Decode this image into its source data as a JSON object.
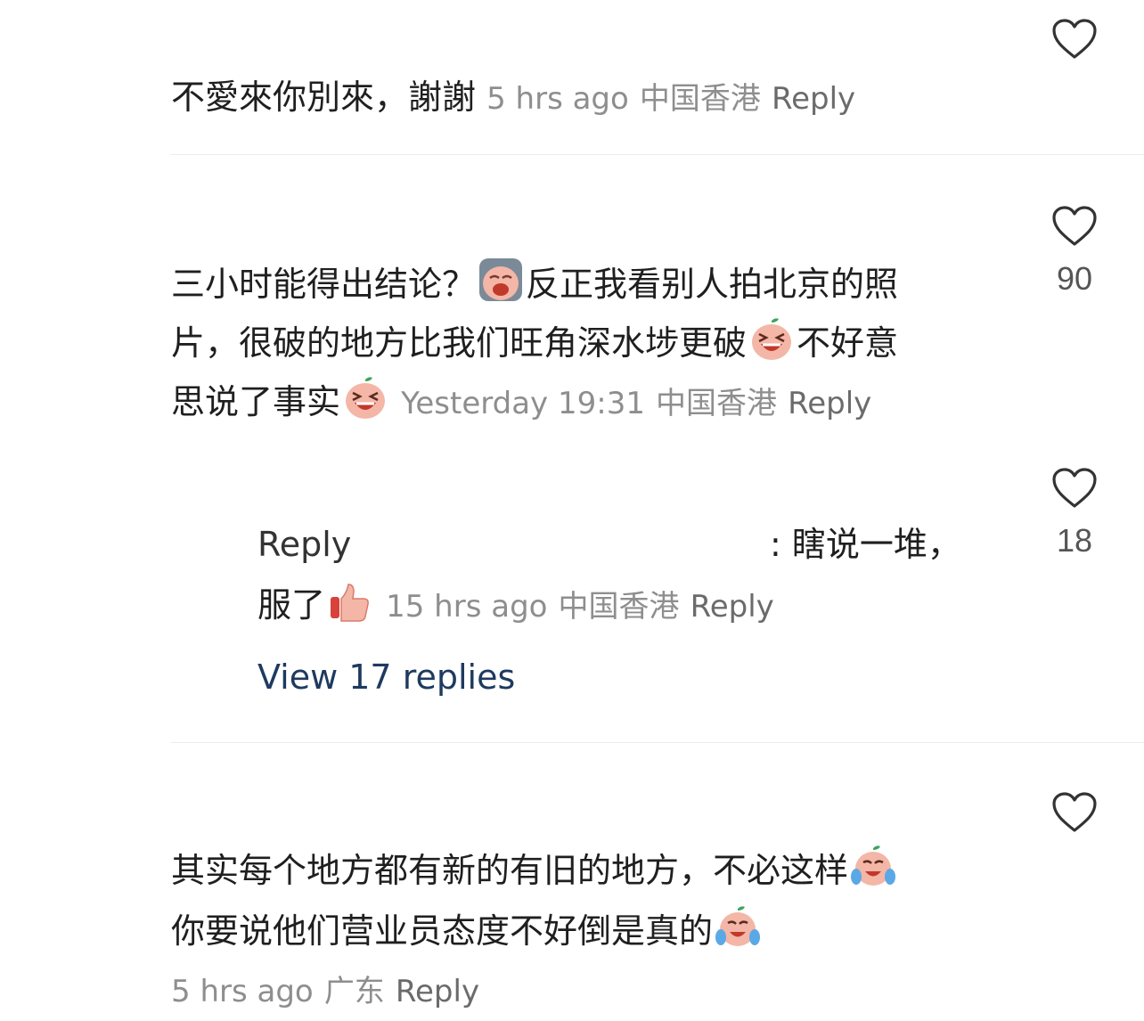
{
  "comments": [
    {
      "text": "不愛來你別來，謝謝",
      "time": "5 hrs ago",
      "location": "中国香港",
      "reply_label": "Reply",
      "likes": ""
    },
    {
      "line1": "三小时能得出结论？",
      "line1b": "反正我看别人拍北京的照",
      "line2": "片，很破的地方比我们旺角深水埗更破",
      "line2b": "不好意",
      "line3": "思说了事实",
      "time": "Yesterday 19:31",
      "location": "中国香港",
      "reply_label": "Reply",
      "likes": "90"
    },
    {
      "text_start": "其实每个地方都有新的有旧的地方，不必这样",
      "text_line2": "你要说他们营业员态度不好倒是真的",
      "time": "5 hrs ago",
      "location": "广东",
      "reply_label": "Reply",
      "likes": ""
    }
  ],
  "reply": {
    "prefix": "Reply",
    "text_tail": ": 瞎说一堆，",
    "line2": "服了",
    "time": "15 hrs ago",
    "location": "中国香港",
    "reply_label": "Reply",
    "likes": "18",
    "view_replies": "View 17 replies"
  },
  "icons": {
    "heart": "heart-outline-icon",
    "emoji_sad": "crying-face-emoji",
    "emoji_laugh": "laughing-face-emoji",
    "emoji_thumb": "thumbs-up-emoji",
    "emoji_tears": "tears-of-joy-emoji"
  },
  "colors": {
    "text": "#1f1f1f",
    "meta": "#8e8e8e",
    "link": "#1e3a5f",
    "divider": "#ececec"
  }
}
